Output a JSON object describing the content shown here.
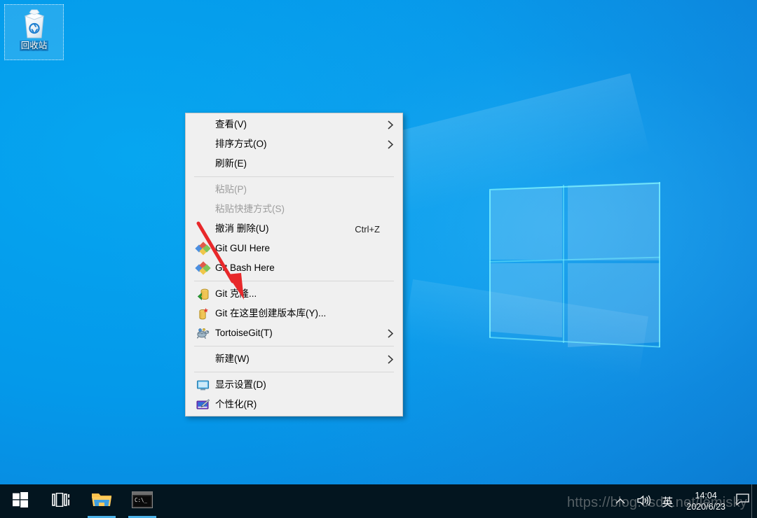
{
  "desktop": {
    "icons": [
      {
        "name": "recycle-bin",
        "label": "回收站",
        "icon": "recycle-bin-icon",
        "selected": true
      }
    ],
    "wallpaper": "windows-10-hero-light"
  },
  "context_menu": {
    "title": "desktop-context-menu",
    "groups": [
      {
        "items": [
          {
            "label": "查看(V)",
            "icon": "",
            "accel": "",
            "submenu": true,
            "disabled": false
          },
          {
            "label": "排序方式(O)",
            "icon": "",
            "accel": "",
            "submenu": true,
            "disabled": false
          },
          {
            "label": "刷新(E)",
            "icon": "",
            "accel": "",
            "submenu": false,
            "disabled": false
          }
        ]
      },
      {
        "items": [
          {
            "label": "粘贴(P)",
            "icon": "",
            "accel": "",
            "submenu": false,
            "disabled": true
          },
          {
            "label": "粘贴快捷方式(S)",
            "icon": "",
            "accel": "",
            "submenu": false,
            "disabled": true
          },
          {
            "label": "撤消 删除(U)",
            "icon": "",
            "accel": "Ctrl+Z",
            "submenu": false,
            "disabled": false
          },
          {
            "label": "Git GUI Here",
            "icon": "git-diamonds-icon",
            "accel": "",
            "submenu": false,
            "disabled": false
          },
          {
            "label": "Git Bash Here",
            "icon": "git-diamonds-icon",
            "accel": "",
            "submenu": false,
            "disabled": false
          }
        ]
      },
      {
        "items": [
          {
            "label": "Git 克隆...",
            "icon": "git-clone-icon",
            "accel": "",
            "submenu": false,
            "disabled": false
          },
          {
            "label": "Git 在这里创建版本库(Y)...",
            "icon": "git-create-repo-icon",
            "accel": "",
            "submenu": false,
            "disabled": false
          },
          {
            "label": "TortoiseGit(T)",
            "icon": "tortoisegit-icon",
            "accel": "",
            "submenu": true,
            "disabled": false
          }
        ]
      },
      {
        "items": [
          {
            "label": "新建(W)",
            "icon": "",
            "accel": "",
            "submenu": true,
            "disabled": false
          }
        ]
      },
      {
        "items": [
          {
            "label": "显示设置(D)",
            "icon": "display-settings-icon",
            "accel": "",
            "submenu": false,
            "disabled": false
          },
          {
            "label": "个性化(R)",
            "icon": "personalize-icon",
            "accel": "",
            "submenu": false,
            "disabled": false
          }
        ]
      }
    ]
  },
  "annotation": {
    "type": "red-arrow",
    "color": "#e8282a",
    "points_to": "Git 克隆..."
  },
  "taskbar": {
    "buttons": [
      {
        "name": "start-button",
        "icon": "windows-logo-icon",
        "active": false
      },
      {
        "name": "task-view-button",
        "icon": "task-view-icon",
        "active": false
      },
      {
        "name": "file-explorer-button",
        "icon": "folder-icon",
        "active": true
      },
      {
        "name": "command-prompt-button",
        "icon": "console-icon",
        "active": true
      }
    ],
    "tray": {
      "show_hidden_icons": "chevron-up-icon",
      "volume": "speaker-icon",
      "ime": "英",
      "action_center": "action-center-icon"
    },
    "clock": {
      "time": "14:04",
      "date": "2020/6/23"
    }
  },
  "watermark": {
    "text": "https://blog.csdn.net/lemisky"
  },
  "colors": {
    "desktop_blue": "#0a9bee",
    "menu_bg": "#f0f0f0",
    "menu_border": "#c6c6c6",
    "taskbar_bg": "#03151f",
    "accent": "#4cb2e8",
    "annotation_red": "#e8282a",
    "disabled_text": "#9d9d9d"
  }
}
